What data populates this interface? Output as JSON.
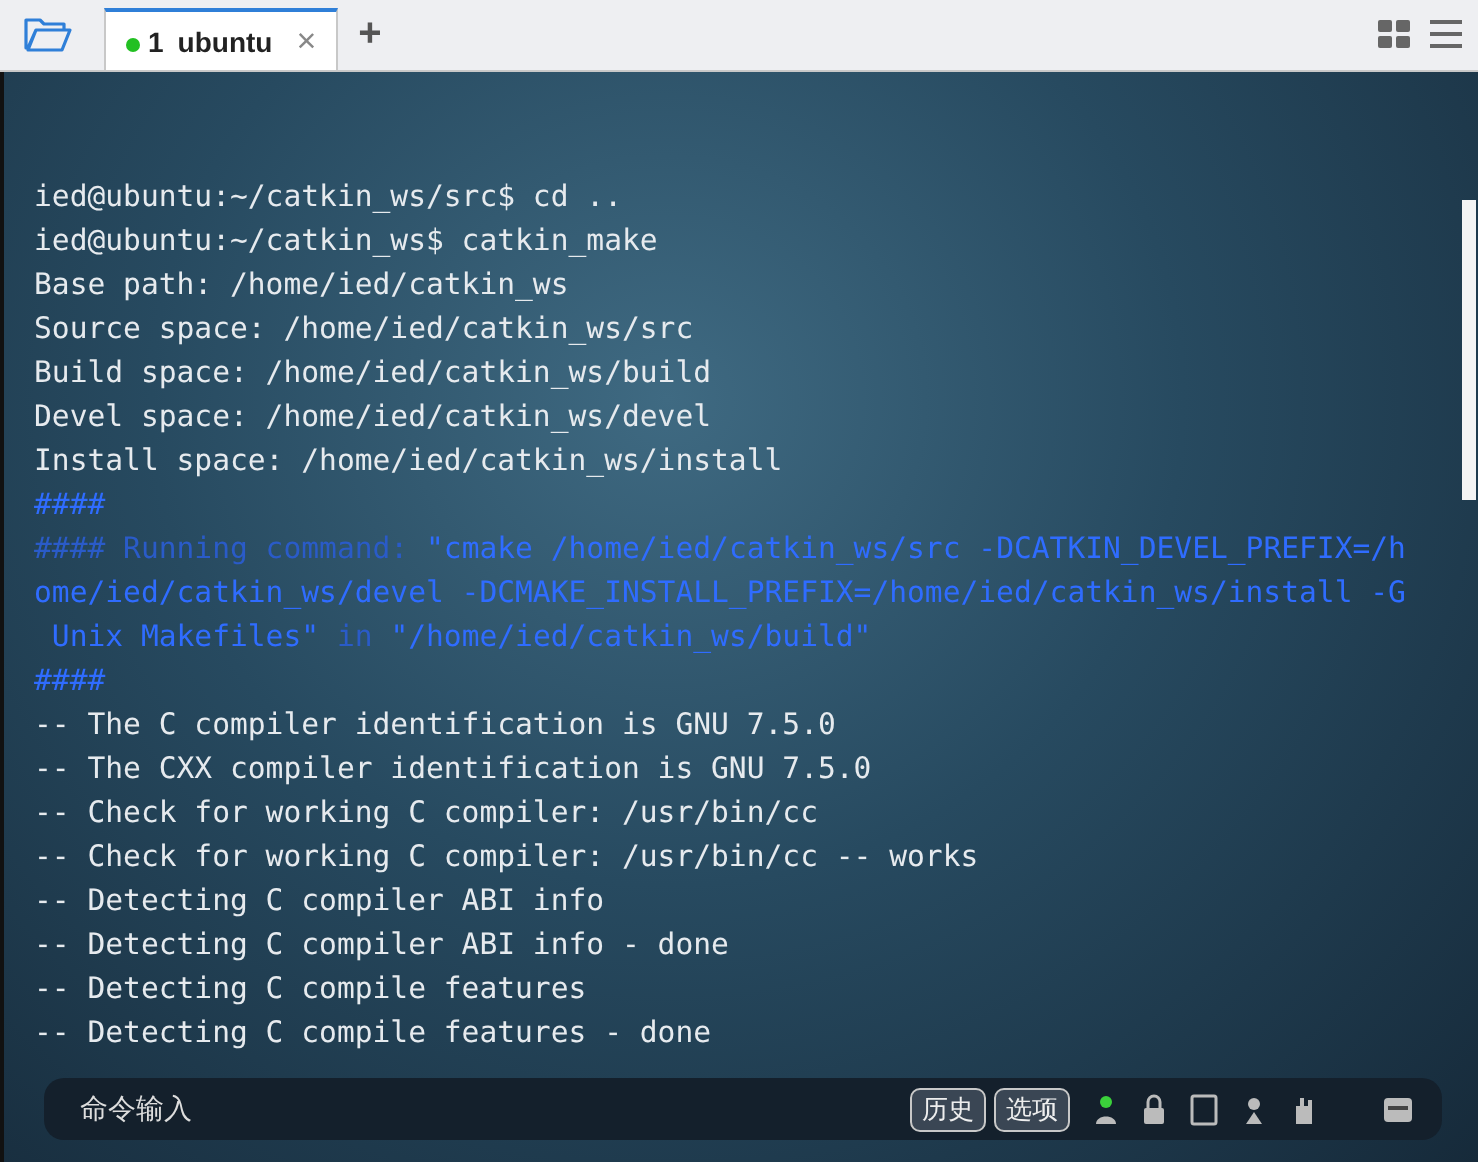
{
  "tabs": [
    {
      "number": "1",
      "label": "ubuntu",
      "selected": true,
      "connected": true,
      "close": "×"
    }
  ],
  "new_tab": "+",
  "terminal": {
    "lines": [
      {
        "segments": [
          {
            "text": "ied@ubuntu:~/catkin_ws/src$ cd ..",
            "kind": "plain"
          }
        ]
      },
      {
        "segments": [
          {
            "text": "ied@ubuntu:~/catkin_ws$ catkin_make",
            "kind": "plain"
          }
        ]
      },
      {
        "segments": [
          {
            "text": "Base path: /home/ied/catkin_ws",
            "kind": "plain"
          }
        ]
      },
      {
        "segments": [
          {
            "text": "Source space: /home/ied/catkin_ws/src",
            "kind": "plain"
          }
        ]
      },
      {
        "segments": [
          {
            "text": "Build space: /home/ied/catkin_ws/build",
            "kind": "plain"
          }
        ]
      },
      {
        "segments": [
          {
            "text": "Devel space: /home/ied/catkin_ws/devel",
            "kind": "plain"
          }
        ]
      },
      {
        "segments": [
          {
            "text": "Install space: /home/ied/catkin_ws/install",
            "kind": "plain"
          }
        ]
      },
      {
        "segments": [
          {
            "text": "####",
            "kind": "bright"
          }
        ]
      },
      {
        "segments": [
          {
            "text": "#### Running command: ",
            "kind": "dim"
          },
          {
            "text": "\"cmake /home/ied/catkin_ws/src -DCATKIN_DEVEL_PREFIX=/h",
            "kind": "bright"
          }
        ]
      },
      {
        "segments": [
          {
            "text": "ome/ied/catkin_ws/devel -DCMAKE_INSTALL_PREFIX=/home/ied/catkin_ws/install -G",
            "kind": "bright"
          }
        ]
      },
      {
        "segments": [
          {
            "text": " Unix Makefiles\"",
            "kind": "bright"
          },
          {
            "text": " in ",
            "kind": "dim"
          },
          {
            "text": "\"/home/ied/catkin_ws/build\"",
            "kind": "bright"
          }
        ]
      },
      {
        "segments": [
          {
            "text": "####",
            "kind": "bright"
          }
        ]
      },
      {
        "segments": [
          {
            "text": "-- The C compiler identification is GNU 7.5.0",
            "kind": "plain"
          }
        ]
      },
      {
        "segments": [
          {
            "text": "-- The CXX compiler identification is GNU 7.5.0",
            "kind": "plain"
          }
        ]
      },
      {
        "segments": [
          {
            "text": "-- Check for working C compiler: /usr/bin/cc",
            "kind": "plain"
          }
        ]
      },
      {
        "segments": [
          {
            "text": "-- Check for working C compiler: /usr/bin/cc -- works",
            "kind": "plain"
          }
        ]
      },
      {
        "segments": [
          {
            "text": "-- Detecting C compiler ABI info",
            "kind": "plain"
          }
        ]
      },
      {
        "segments": [
          {
            "text": "-- Detecting C compiler ABI info - done",
            "kind": "plain"
          }
        ]
      },
      {
        "segments": [
          {
            "text": "-- Detecting C compile features",
            "kind": "plain"
          }
        ]
      },
      {
        "segments": [
          {
            "text": "-- Detecting C compile features - done",
            "kind": "plain"
          }
        ]
      }
    ]
  },
  "command_bar": {
    "placeholder": "命令输入",
    "buttons": [
      "历史",
      "选项"
    ]
  }
}
